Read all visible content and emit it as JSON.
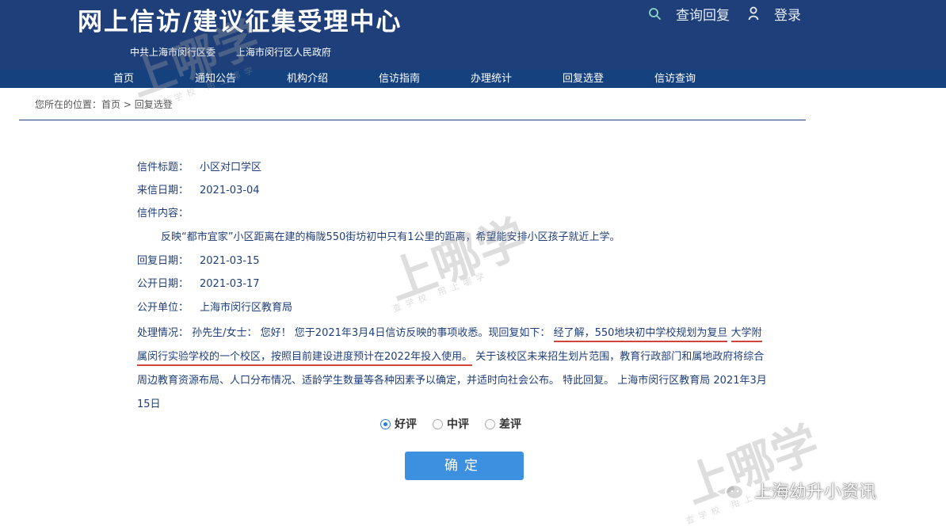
{
  "header": {
    "site_title": "网上信访/建议征集受理中心",
    "subtitle_1": "中共上海市闵行区委",
    "subtitle_2": "上海市闵行区人民政府",
    "search_label": "查询回复",
    "login_label": "登录"
  },
  "nav": {
    "items": [
      "首页",
      "通知公告",
      "机构介绍",
      "信访指南",
      "办理统计",
      "回复选登",
      "信访查询"
    ]
  },
  "breadcrumb": {
    "prefix": "您所在的位置：",
    "home": "首页",
    "sep": " > ",
    "current": "回复选登"
  },
  "letter": {
    "title_label": "信件标题：",
    "title_value": "小区对口学区",
    "date_label": "来信日期：",
    "date_value": "2021-03-04",
    "content_label": "信件内容：",
    "content_value": "反映“都市宜家”小区距离在建的梅陇550街坊初中只有1公里的距离，希望能安排小区孩子就近上学。",
    "reply_date_label": "回复日期：",
    "reply_date_value": "2021-03-15",
    "public_date_label": "公开日期：",
    "public_date_value": "2021-03-17",
    "public_unit_label": "公开单位：",
    "public_unit_value": "上海市闵行区教育局",
    "handling_label": "处理情况：",
    "handling_part1": "孙先生/女士：  您好！ 您于2021年3月4日信访反映的事项收悉。现回复如下：",
    "handling_highlight1": "经了解，550地块初中学校规划为复旦",
    "handling_highlight2": "大学附属闵行实验学校的一个校区，按照目前建设进度预计在2022年投入使用。",
    "handling_part2": "关于该校区未来招生划片范围，教育行政部门和属地政府将综合周边教育资源布局、人口分布情况、适龄学生数量等各种因素予以确定，并适时向社会公布。 特此回复。 上海市闵行区教育局 2021年3月15日"
  },
  "rating": {
    "options": [
      "好评",
      "中评",
      "差评"
    ],
    "selected": "好评"
  },
  "confirm_label": "确定",
  "watermark": {
    "main": "上哪学",
    "sub": "查学校 用上哪学"
  },
  "wechat_account": "上海幼升小资讯"
}
